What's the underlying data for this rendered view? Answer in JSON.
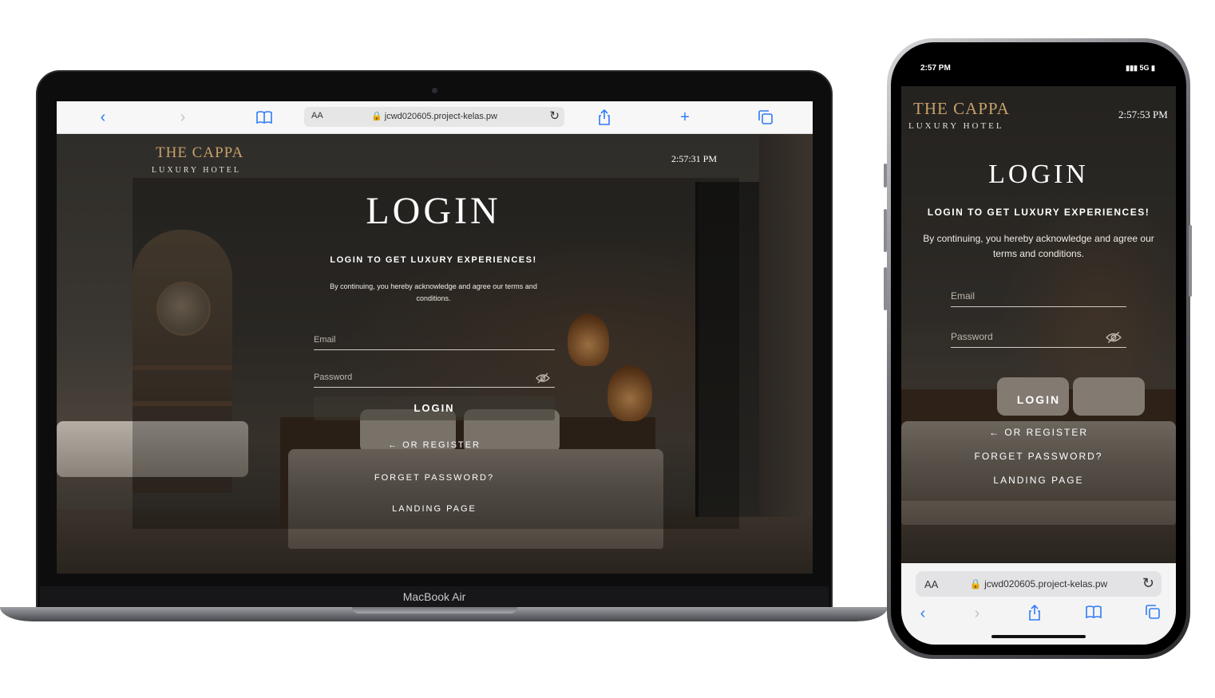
{
  "desktop": {
    "device_label": "MacBook Air",
    "safari": {
      "text_size": "AA",
      "url": "jcwd020605.project-kelas.pw"
    },
    "page": {
      "brand_name": "THE CAPPA",
      "brand_tagline": "LUXURY HOTEL",
      "clock": "2:57:31 PM",
      "title": "LOGIN",
      "subtitle": "LOGIN TO GET LUXURY EXPERIENCES!",
      "terms": "By continuing, you hereby acknowledge and agree our terms and conditions.",
      "email_placeholder": "Email",
      "password_placeholder": "Password",
      "login_button": "LOGIN",
      "register_link": "OR REGISTER",
      "forget_link": "FORGET PASSWORD?",
      "landing_link": "LANDING PAGE"
    }
  },
  "mobile": {
    "status": {
      "time": "2:57 PM",
      "network": "5G"
    },
    "safari": {
      "text_size": "AA",
      "url": "jcwd020605.project-kelas.pw"
    },
    "page": {
      "brand_name": "THE CAPPA",
      "brand_tagline": "LUXURY HOTEL",
      "clock": "2:57:53 PM",
      "title": "LOGIN",
      "subtitle": "LOGIN TO GET LUXURY EXPERIENCES!",
      "terms": "By continuing, you hereby acknowledge and agree our terms and conditions.",
      "email_placeholder": "Email",
      "password_placeholder": "Password",
      "login_button": "LOGIN",
      "register_link": "OR REGISTER",
      "forget_link": "FORGET PASSWORD?",
      "landing_link": "LANDING PAGE"
    }
  },
  "icons": {
    "back": "chevron-left-icon",
    "forward": "chevron-right-icon",
    "bookmarks": "book-icon",
    "lock": "lock-icon",
    "reload": "reload-icon",
    "share": "share-icon",
    "new_tab": "plus-icon",
    "tabs": "tabs-icon",
    "password_toggle": "eye-off-icon",
    "register_arrow": "arrow-left-icon"
  },
  "colors": {
    "brand_gold": "#c8a06a",
    "safari_blue": "#2f7cf6"
  }
}
